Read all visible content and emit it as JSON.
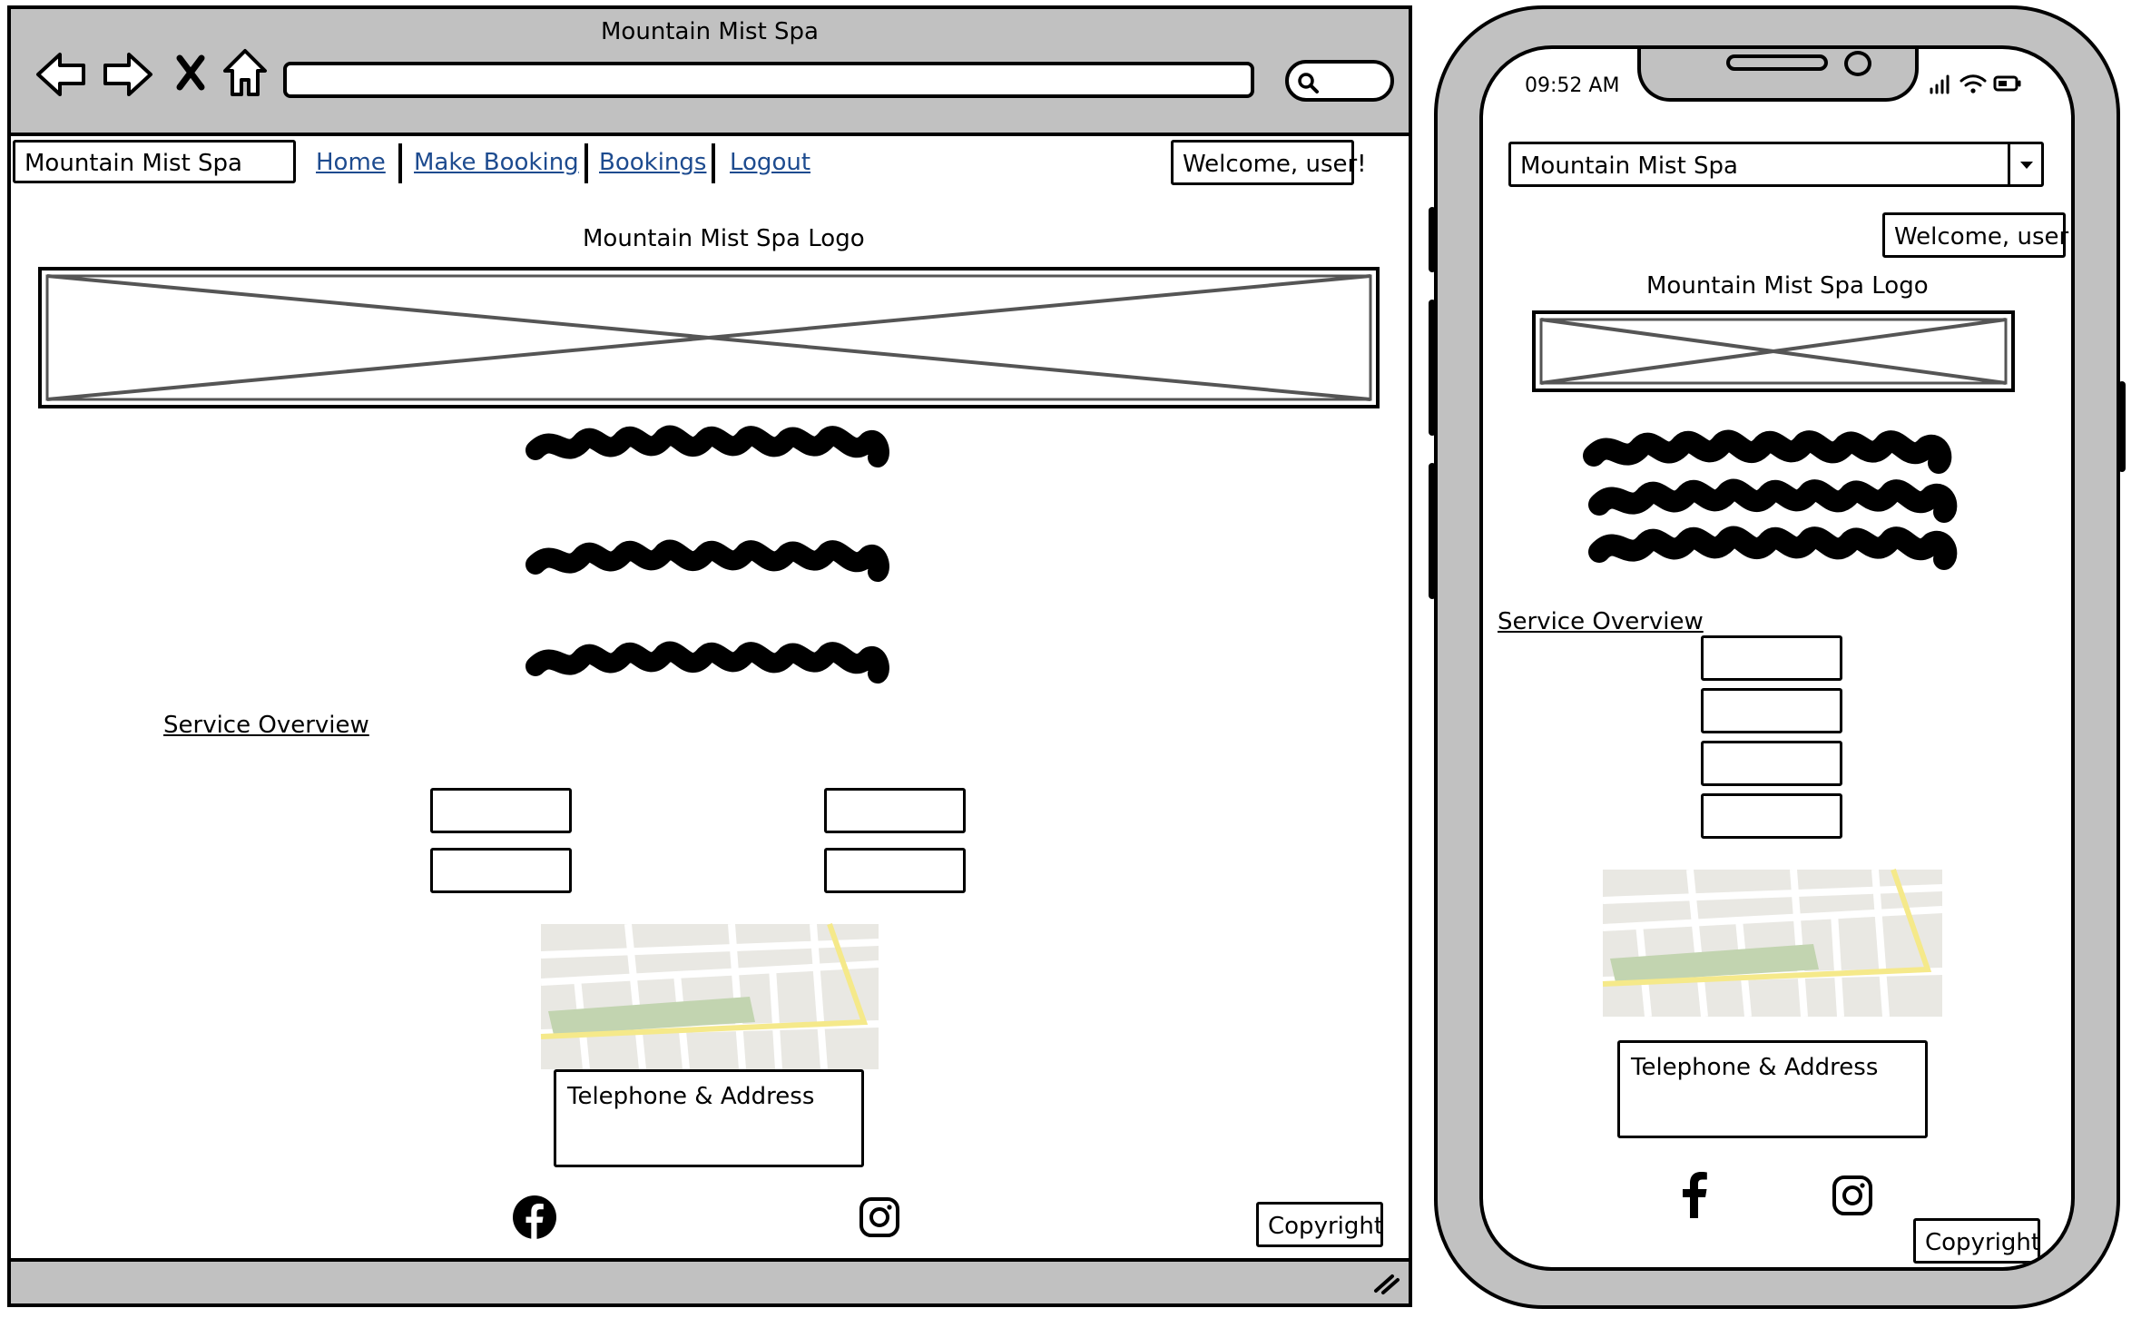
{
  "browser": {
    "window_title": "Mountain Mist Spa",
    "site_name": "Mountain Mist Spa",
    "nav": [
      {
        "label": "Home"
      },
      {
        "label": "Make Booking"
      },
      {
        "label": "Bookings"
      },
      {
        "label": "Logout"
      }
    ],
    "welcome": "Welcome, user!",
    "logo_label": "Mountain Mist Spa Logo",
    "service_link": "Service Overview",
    "contact_label": "Telephone & Address",
    "copyright": "Copyright",
    "toolbar_icons": [
      "back-arrow-icon",
      "forward-arrow-icon",
      "close-icon",
      "home-icon",
      "search-icon"
    ],
    "social_icons": [
      "facebook-icon",
      "instagram-icon"
    ]
  },
  "phone": {
    "time": "09:52 AM",
    "site_select": "Mountain Mist Spa",
    "welcome": "Welcome, user!",
    "logo_label": "Mountain Mist Spa Logo",
    "service_link": "Service Overview",
    "contact_label": "Telephone & Address",
    "copyright": "Copyright",
    "status_icons": [
      "signal-icon",
      "wifi-icon",
      "battery-icon"
    ],
    "social_icons": [
      "facebook-icon",
      "instagram-icon"
    ]
  },
  "colors": {
    "frame_gray": "#c1c1c1",
    "link_blue": "#1d4b8f",
    "map_bg": "#e9e8e3",
    "map_park": "#c2d4b0",
    "map_road_yellow": "#f5e98a"
  }
}
